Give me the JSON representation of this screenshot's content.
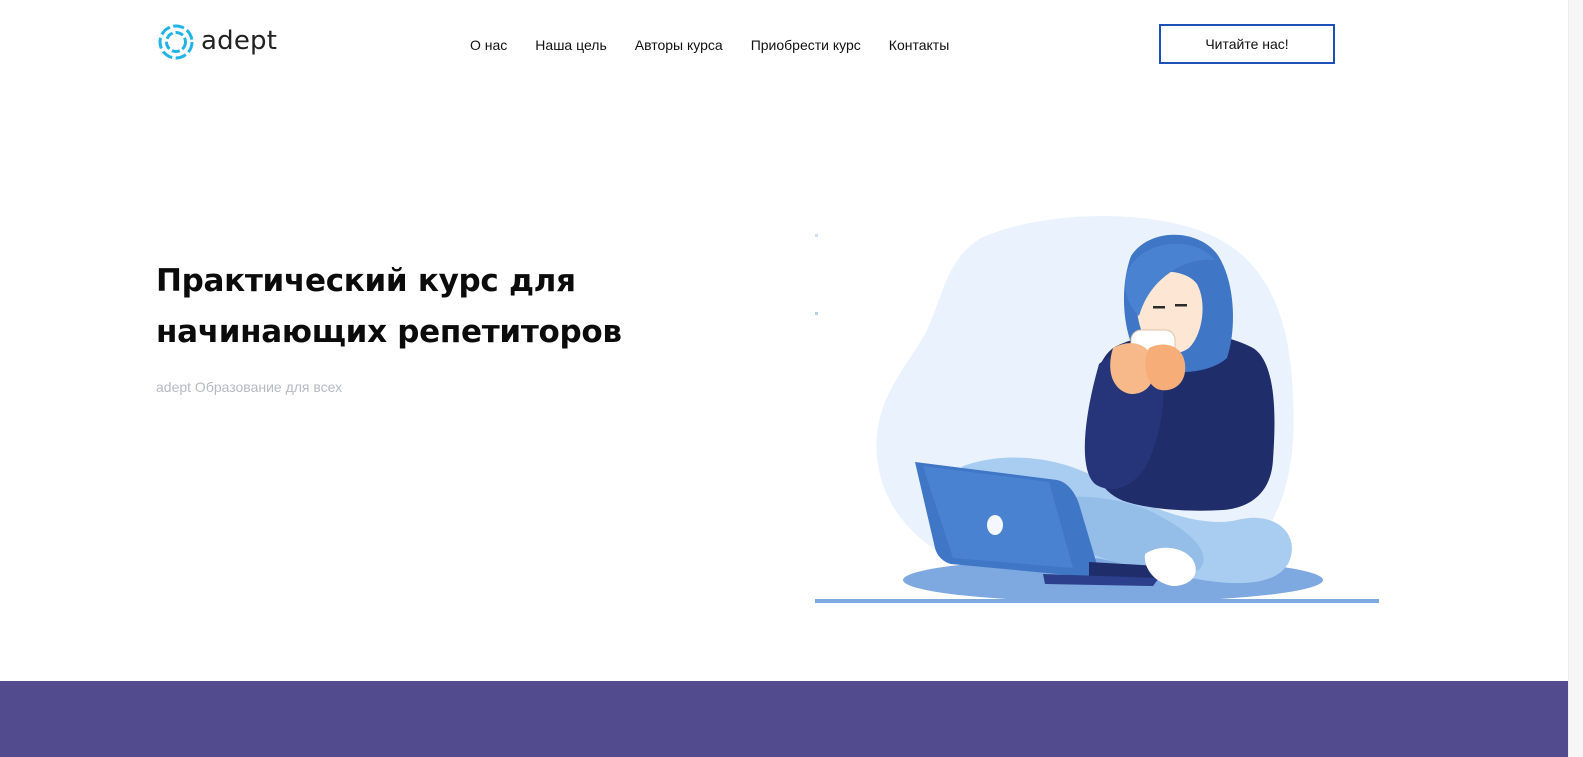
{
  "brand": {
    "name": "adept",
    "logo_color": "#1fb3e6"
  },
  "nav": {
    "items": [
      {
        "label": "О нас"
      },
      {
        "label": "Наша цель"
      },
      {
        "label": "Авторы курса"
      },
      {
        "label": "Приобрести курс"
      },
      {
        "label": "Контакты"
      }
    ]
  },
  "header": {
    "cta_label": "Читайте нас!",
    "cta_border_color": "#1d4fb8"
  },
  "hero": {
    "title_line1": "Практический курс для",
    "title_line2": "начинающих репетиторов",
    "subtitle": "adept Образование для всех",
    "illustration": "woman-with-laptop-illustration"
  },
  "colors": {
    "band": "#524b8e",
    "accent_blue": "#3f76c5",
    "navy": "#1f2d6b",
    "light_blue": "#a9cdf0",
    "blob": "#eaf3fd"
  },
  "icons": {
    "logo": "ring-logo-icon",
    "laptop_logo": "apple-dot-icon"
  }
}
